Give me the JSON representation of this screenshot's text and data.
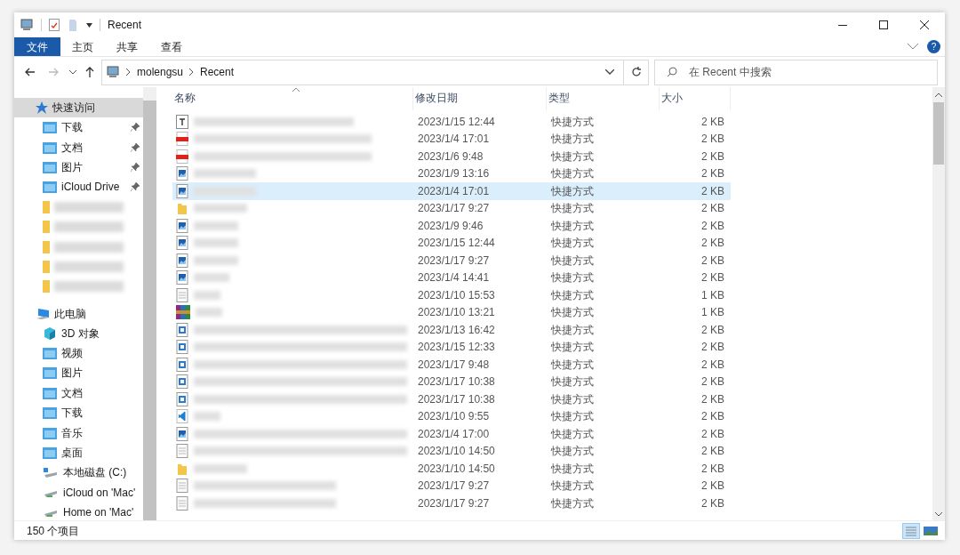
{
  "window": {
    "title": "Recent"
  },
  "ribbon_tabs": [
    {
      "label": "文件",
      "selected": true
    },
    {
      "label": "主页",
      "selected": false
    },
    {
      "label": "共享",
      "selected": false
    },
    {
      "label": "查看",
      "selected": false
    }
  ],
  "help": {
    "label": "?"
  },
  "address": {
    "path": [
      "molengsu",
      "Recent"
    ]
  },
  "search": {
    "placeholder": "在 Recent 中搜索"
  },
  "sidebar": {
    "items": [
      {
        "label": "快速访问",
        "kind": "quick",
        "selected": true,
        "children": [
          {
            "label": "下载",
            "kind": "folder",
            "pinned": true
          },
          {
            "label": "文档",
            "kind": "folder",
            "pinned": true
          },
          {
            "label": "图片",
            "kind": "folder",
            "pinned": true
          },
          {
            "label": "iCloud Drive",
            "kind": "folder",
            "pinned": true
          },
          {
            "kind": "redacted"
          },
          {
            "kind": "redacted"
          },
          {
            "kind": "redacted"
          },
          {
            "kind": "redacted"
          },
          {
            "kind": "redacted"
          }
        ]
      },
      {
        "label": "此电脑",
        "kind": "pc",
        "selected": false,
        "children": [
          {
            "label": "3D 对象",
            "kind": "cube"
          },
          {
            "label": "视频",
            "kind": "folder"
          },
          {
            "label": "图片",
            "kind": "folder"
          },
          {
            "label": "文档",
            "kind": "folder"
          },
          {
            "label": "下载",
            "kind": "folder"
          },
          {
            "label": "音乐",
            "kind": "folder"
          },
          {
            "label": "桌面",
            "kind": "folder"
          },
          {
            "label": "本地磁盘 (C:)",
            "kind": "drive"
          },
          {
            "label": "iCloud on 'Mac'",
            "kind": "network"
          },
          {
            "label": "Home on 'Mac'",
            "kind": "network"
          }
        ]
      }
    ]
  },
  "table": {
    "columns": [
      {
        "label": "名称",
        "sorted": true
      },
      {
        "label": "修改日期",
        "sorted": false
      },
      {
        "label": "类型",
        "sorted": false
      },
      {
        "label": "大小",
        "sorted": false
      }
    ],
    "rows": [
      {
        "kind": "text",
        "modified": "2023/1/15 12:44",
        "type": "快捷方式",
        "size": "2 KB",
        "selected": false
      },
      {
        "kind": "pdf",
        "modified": "2023/1/4 17:01",
        "type": "快捷方式",
        "size": "2 KB",
        "selected": false
      },
      {
        "kind": "pdf",
        "modified": "2023/1/6 9:48",
        "type": "快捷方式",
        "size": "2 KB",
        "selected": false
      },
      {
        "kind": "image",
        "modified": "2023/1/9 13:16",
        "type": "快捷方式",
        "size": "2 KB",
        "selected": false
      },
      {
        "kind": "image",
        "modified": "2023/1/4 17:01",
        "type": "快捷方式",
        "size": "2 KB",
        "selected": true
      },
      {
        "kind": "folder",
        "modified": "2023/1/17 9:27",
        "type": "快捷方式",
        "size": "2 KB",
        "selected": false
      },
      {
        "kind": "image",
        "modified": "2023/1/9 9:46",
        "type": "快捷方式",
        "size": "2 KB",
        "selected": false
      },
      {
        "kind": "image",
        "modified": "2023/1/15 12:44",
        "type": "快捷方式",
        "size": "2 KB",
        "selected": false
      },
      {
        "kind": "image",
        "modified": "2023/1/17 9:27",
        "type": "快捷方式",
        "size": "2 KB",
        "selected": false
      },
      {
        "kind": "image",
        "modified": "2023/1/4 14:41",
        "type": "快捷方式",
        "size": "2 KB",
        "selected": false
      },
      {
        "kind": "plain",
        "modified": "2023/1/10 15:53",
        "type": "快捷方式",
        "size": "1 KB",
        "selected": false
      },
      {
        "kind": "archive",
        "modified": "2023/1/10 13:21",
        "type": "快捷方式",
        "size": "1 KB",
        "selected": false
      },
      {
        "kind": "doc",
        "modified": "2023/1/13 16:42",
        "type": "快捷方式",
        "size": "2 KB",
        "selected": false
      },
      {
        "kind": "doc",
        "modified": "2023/1/15 12:33",
        "type": "快捷方式",
        "size": "2 KB",
        "selected": false
      },
      {
        "kind": "doc",
        "modified": "2023/1/17 9:48",
        "type": "快捷方式",
        "size": "2 KB",
        "selected": false
      },
      {
        "kind": "doc",
        "modified": "2023/1/17 10:38",
        "type": "快捷方式",
        "size": "2 KB",
        "selected": false
      },
      {
        "kind": "doc",
        "modified": "2023/1/17 10:38",
        "type": "快捷方式",
        "size": "2 KB",
        "selected": false
      },
      {
        "kind": "code",
        "modified": "2023/1/10 9:55",
        "type": "快捷方式",
        "size": "2 KB",
        "selected": false
      },
      {
        "kind": "image",
        "modified": "2023/1/4 17:00",
        "type": "快捷方式",
        "size": "2 KB",
        "selected": false
      },
      {
        "kind": "plain",
        "modified": "2023/1/10 14:50",
        "type": "快捷方式",
        "size": "2 KB",
        "selected": false
      },
      {
        "kind": "folder",
        "modified": "2023/1/10 14:50",
        "type": "快捷方式",
        "size": "2 KB",
        "selected": false
      },
      {
        "kind": "plain",
        "modified": "2023/1/17 9:27",
        "type": "快捷方式",
        "size": "2 KB",
        "selected": false
      },
      {
        "kind": "plain",
        "modified": "2023/1/17 9:27",
        "type": "快捷方式",
        "size": "2 KB",
        "selected": false
      }
    ]
  },
  "status_bar": {
    "item_count": "150 个项目"
  },
  "view_buttons": [
    {
      "kind": "details",
      "selected": true
    },
    {
      "kind": "large-icons",
      "selected": false
    }
  ]
}
